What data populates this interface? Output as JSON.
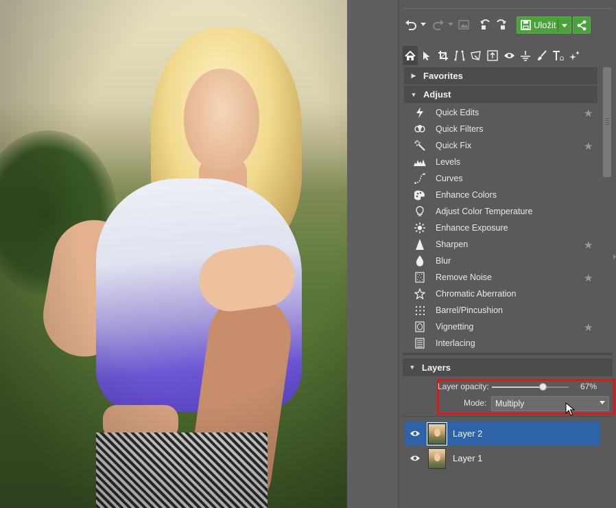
{
  "toolbar": {
    "save_label": "Uložit"
  },
  "adjust": {
    "favorites_label": "Favorites",
    "adjust_label": "Adjust",
    "items": [
      {
        "label": "Quick Edits",
        "icon": "lightning-icon",
        "starred": true
      },
      {
        "label": "Quick Filters",
        "icon": "filters-icon",
        "starred": false
      },
      {
        "label": "Quick Fix",
        "icon": "magic-wand-icon",
        "starred": true
      },
      {
        "label": "Levels",
        "icon": "levels-icon",
        "starred": false
      },
      {
        "label": "Curves",
        "icon": "curves-icon",
        "starred": false
      },
      {
        "label": "Enhance Colors",
        "icon": "palette-icon",
        "starred": false
      },
      {
        "label": "Adjust Color Temperature",
        "icon": "bulb-icon",
        "starred": false
      },
      {
        "label": "Enhance Exposure",
        "icon": "sun-icon",
        "starred": false
      },
      {
        "label": "Sharpen",
        "icon": "sharpen-icon",
        "starred": true
      },
      {
        "label": "Blur",
        "icon": "drop-icon",
        "starred": false
      },
      {
        "label": "Remove Noise",
        "icon": "noise-icon",
        "starred": true
      },
      {
        "label": "Chromatic Aberration",
        "icon": "star-outline-icon",
        "starred": false
      },
      {
        "label": "Barrel/Pincushion",
        "icon": "grid-icon",
        "starred": true
      },
      {
        "label": "Vignetting",
        "icon": "vignette-icon",
        "starred": true
      },
      {
        "label": "Interlacing",
        "icon": "interlace-icon",
        "starred": false
      }
    ]
  },
  "layers": {
    "title": "Layers",
    "opacity_label": "Layer opacity:",
    "opacity_value": "67%",
    "opacity_fraction": 0.67,
    "mode_label": "Mode:",
    "mode_value": "Multiply",
    "rows": [
      {
        "name": "Layer 2",
        "selected": true
      },
      {
        "name": "Layer 1",
        "selected": false
      }
    ]
  },
  "colors": {
    "accent_green": "#49a33a",
    "selection_blue": "#2f63a8",
    "highlight_red": "#e01717"
  }
}
